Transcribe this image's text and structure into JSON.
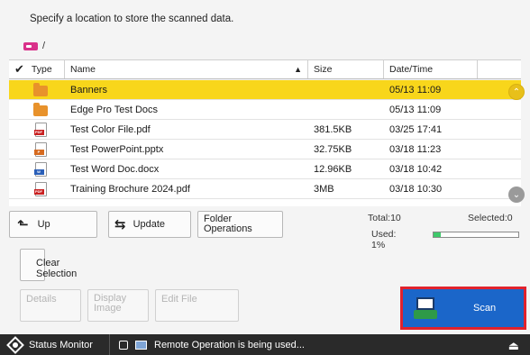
{
  "instruction": "Specify a location to store the scanned data.",
  "path": "/",
  "table": {
    "columns": {
      "check": "✔",
      "type": "Type",
      "name": "Name",
      "sort": "▲",
      "size": "Size",
      "date": "Date/Time"
    },
    "rows": [
      {
        "icon": "folder",
        "name": "Banners",
        "size": "",
        "date": "05/13 11:09",
        "selected": true
      },
      {
        "icon": "folder",
        "name": "Edge Pro Test Docs",
        "size": "",
        "date": "05/13 11:09",
        "selected": false
      },
      {
        "icon": "pdf",
        "name": "Test Color File.pdf",
        "size": "381.5KB",
        "date": "03/25 17:41",
        "selected": false
      },
      {
        "icon": "pptx",
        "name": "Test PowerPoint.pptx",
        "size": "32.75KB",
        "date": "03/18 11:23",
        "selected": false
      },
      {
        "icon": "docx",
        "name": "Test Word Doc.docx",
        "size": "12.96KB",
        "date": "03/18 10:42",
        "selected": false
      },
      {
        "icon": "pdf",
        "name": "Training Brochure 2024.pdf",
        "size": "3MB",
        "date": "03/18 10:30",
        "selected": false
      }
    ]
  },
  "buttons": {
    "up": "Up",
    "update": "Update",
    "folder_line1": "Folder",
    "folder_line2": "Operations",
    "clear_line1": "Clear",
    "clear_line2": "Selection",
    "details": "Details",
    "display_line1": "Display",
    "display_line2": "Image",
    "edit": "Edit File",
    "scan": "Scan"
  },
  "totals": {
    "total": "Total:10",
    "selected": "Selected:0",
    "used": "Used: 1%",
    "used_fraction": 0.08
  },
  "status": {
    "monitor": "Status Monitor",
    "remote": "Remote Operation is being used..."
  },
  "colors": {
    "selected_row": "#f8d61b",
    "scan_button": "#1b66c9",
    "scan_highlight": "#e0222d",
    "folder": "#e8922b"
  }
}
